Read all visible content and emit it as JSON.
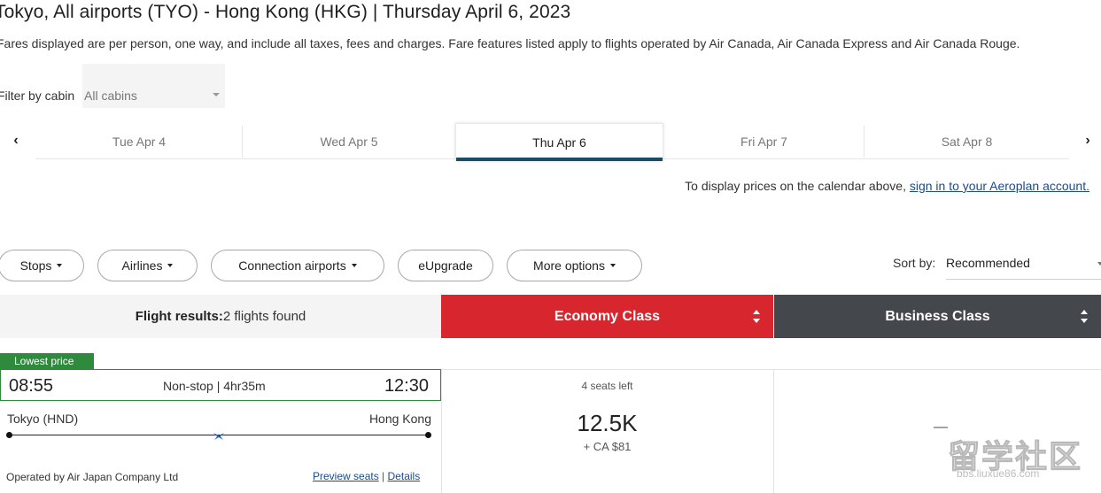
{
  "header": {
    "title": "Tokyo, All airports (TYO) - Hong Kong (HKG)  |  Thursday April 6, 2023",
    "subtitle": "Fares displayed are per person, one way, and include all taxes, fees and charges. Fare features listed apply to flights operated by Air Canada, Air Canada Express and Air Canada Rouge."
  },
  "filter": {
    "label": "Filter by cabin",
    "selected": "All cabins"
  },
  "date_tabs": [
    {
      "label": "Tue Apr 4",
      "active": false
    },
    {
      "label": "Wed Apr 5",
      "active": false
    },
    {
      "label": "Thu Apr 6",
      "active": true
    },
    {
      "label": "Fri Apr 7",
      "active": false
    },
    {
      "label": "Sat Apr 8",
      "active": false
    }
  ],
  "nav": {
    "prev": "‹",
    "next": "›"
  },
  "aeroplan": {
    "text": "To display prices on the calendar above, ",
    "link": "sign in to your Aeroplan account."
  },
  "filters": {
    "stops": "Stops",
    "airlines": "Airlines",
    "connection": "Connection airports",
    "eupgrade": "eUpgrade",
    "more": "More options"
  },
  "sort": {
    "label": "Sort by:",
    "selected": "Recommended"
  },
  "results": {
    "label": "Flight results:",
    "count": "2 flights found",
    "economy": "Economy Class",
    "business": "Business Class"
  },
  "flight": {
    "badge": "Lowest price",
    "departure_time": "08:55",
    "arrival_time": "12:30",
    "duration": "Non-stop | 4hr35m",
    "origin": "Tokyo (HND)",
    "destination": "Hong Kong",
    "operated_by": "Operated by Air Japan Company Ltd",
    "preview_seats": "Preview seats",
    "separator": "|",
    "details": "Details",
    "economy": {
      "seats_left": "4 seats left",
      "points": "12.5K",
      "taxes": "+  CA $81"
    },
    "business": {
      "value": "—"
    }
  },
  "watermark": {
    "big": "留学社区",
    "small": "bbs.liuxue86.com"
  },
  "colors": {
    "economy": "#d8262f",
    "business": "#44484c",
    "badge": "#2f8a3e",
    "active_tab_bar": "#1a4b67",
    "link": "#1a4b8c"
  }
}
